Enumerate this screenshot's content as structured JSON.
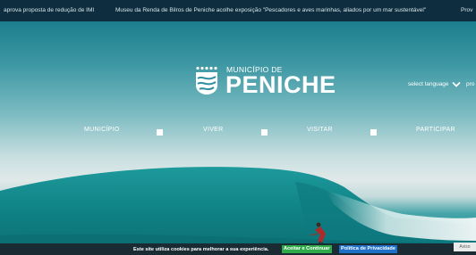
{
  "ticker": {
    "items": [
      "aprova proposta de redução de IMI",
      "Museu da Renda de Bilros de Peniche acolhe exposição \"Pescadores e aves marinhas, aliados por um mar sustentável\"",
      "Prov"
    ]
  },
  "header": {
    "logo_small": "MUNICÍPIO DE",
    "logo_big": "PENICHE",
    "language_label": "select language",
    "language_extra": "pro"
  },
  "nav": {
    "items": [
      "MUNICÍPIO",
      "VIVER",
      "VISITAR",
      "PARTICIPAR"
    ]
  },
  "cookie": {
    "message": "Este site utiliza cookies para melhorar a sua experiência.",
    "accept_label": "Aceitar e Continuar",
    "privacy_label": "Política de Privacidade"
  },
  "side_tag": "Aviso"
}
